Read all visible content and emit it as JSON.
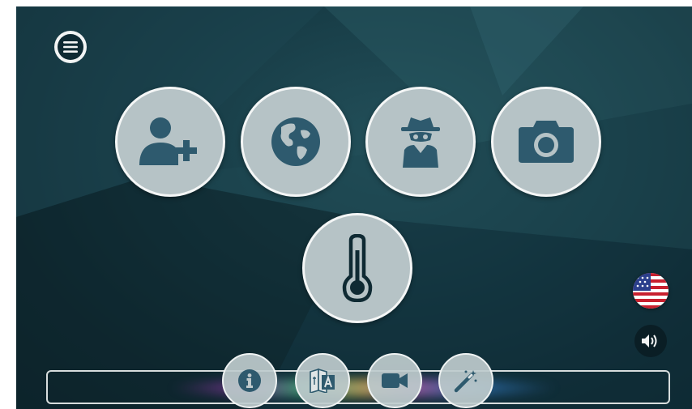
{
  "colors": {
    "background": "#163a44",
    "button_fill": "#b6c3c6",
    "button_border": "#f4f6f6",
    "icon": "#2e5a6e",
    "icon_dark": "#0f2a33"
  },
  "header": {
    "menu_icon": "hamburger-menu-icon"
  },
  "main_buttons": [
    {
      "name": "add-user-button",
      "icon": "add-user-icon"
    },
    {
      "name": "globe-button",
      "icon": "globe-icon"
    },
    {
      "name": "spy-button",
      "icon": "spy-icon"
    },
    {
      "name": "camera-button",
      "icon": "camera-icon"
    },
    {
      "name": "thermometer-button",
      "icon": "thermometer-icon"
    }
  ],
  "side_controls": {
    "language_flag": "us-flag-icon",
    "sound": "volume-icon"
  },
  "bottom_buttons": [
    {
      "name": "info-button",
      "icon": "info-icon"
    },
    {
      "name": "translate-button",
      "icon": "translate-icon"
    },
    {
      "name": "video-button",
      "icon": "video-camera-icon"
    },
    {
      "name": "magic-wand-button",
      "icon": "magic-wand-icon"
    }
  ]
}
